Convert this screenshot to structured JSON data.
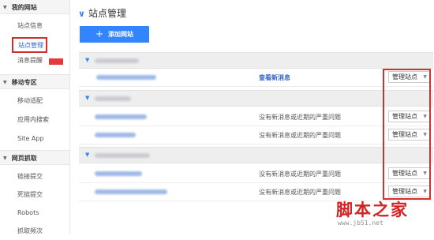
{
  "sidebar": {
    "sections": [
      {
        "label": "我的网站",
        "items": [
          "站点信息",
          "站点管理",
          "消息提醒"
        ]
      },
      {
        "label": "移动专区",
        "items": [
          "移动适配",
          "应用内搜索",
          "Site App"
        ]
      },
      {
        "label": "网页抓取",
        "items": [
          "链接提交",
          "死链提交",
          "Robots",
          "抓取频次"
        ]
      }
    ]
  },
  "main": {
    "title": "站点管理",
    "add_button": "添加网站",
    "groups": [
      {
        "rows": [
          {
            "message": "查看新消息",
            "button": "管理站点"
          }
        ]
      },
      {
        "rows": [
          {
            "message": "没有新消息或近期的严重问题",
            "button": "管理站点"
          },
          {
            "message": "没有新消息或近期的严重问题",
            "button": "管理站点"
          }
        ]
      },
      {
        "rows": [
          {
            "message": "没有新消息或近期的严重问题",
            "button": "管理站点"
          },
          {
            "message": "没有新消息或近期的严重问题",
            "button": "管理站点"
          }
        ]
      }
    ]
  },
  "watermark": {
    "text": "脚本之家",
    "sub": "www.jb51.net"
  },
  "colors": {
    "accent": "#3385ff",
    "highlight": "#d03030"
  }
}
